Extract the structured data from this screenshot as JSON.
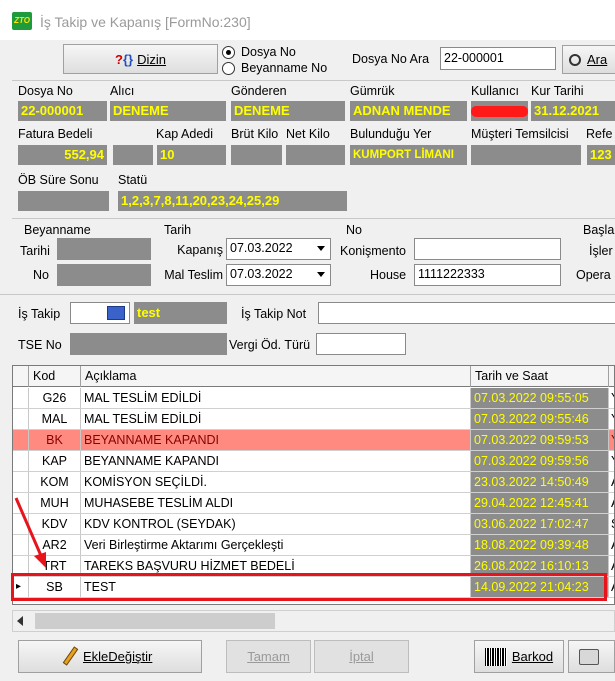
{
  "window": {
    "title": "İş Takip ve Kapanış [FormNo:230]",
    "icon_name": "app-logo-icon",
    "icon_text": "ZTO"
  },
  "toolbar": {
    "dizin_label": "Dizin",
    "radio_dosya": "Dosya No",
    "radio_beyanname": "Beyanname No",
    "radio_selected": "Dosya No",
    "dosya_ara_label": "Dosya No Ara",
    "dosya_ara_value": "22-000001",
    "search_label": "Ara"
  },
  "info": {
    "dosya_no_label": "Dosya No",
    "dosya_no": "22-000001",
    "alici_label": "Alıcı",
    "alici": "DENEME",
    "gonderen_label": "Gönderen",
    "gonderen": "DENEME",
    "gumruk_label": "Gümrük",
    "gumruk": "ADNAN MENDE",
    "kullanici_label": "Kullanıcı",
    "kur_tarihi_label": "Kur Tarihi",
    "kur_tarihi": "31.12.2021",
    "fatura_label": "Fatura Bedeli",
    "fatura": "552,94",
    "kap_adedi_label": "Kap Adedi",
    "kap_adedi": "10",
    "brut_label": "Brüt Kilo",
    "net_label": "Net Kilo",
    "bulundugu_label": "Bulunduğu Yer",
    "bulundugu": "KUMPORT LİMANI",
    "musteri_label": "Müşteri Temsilcisi",
    "refe_label": "Refe",
    "refe": "123",
    "ob_label": "ÖB Süre Sonu",
    "statu_label": "Statü",
    "statu": "1,2,3,7,8,11,20,23,24,25,29"
  },
  "beyanname": {
    "section_label": "Beyanname",
    "tarihi_label": "Tarihi",
    "no_label": "No",
    "tarih_section": "Tarih",
    "kapanis_label": "Kapanış",
    "kapanis": "07.03.2022",
    "mal_teslim_label": "Mal Teslim",
    "mal_teslim": "07.03.2022",
    "no_section": "No",
    "konisme_label": "Konişmento",
    "house_label": "House",
    "house": "1111222333",
    "basla_label": "Başla",
    "islem_label": "İşler",
    "opera_label": "Opera"
  },
  "is_takip": {
    "label": "İş Takip",
    "value": "test",
    "not_label": "İş Takip Not",
    "tse_label": "TSE No",
    "vergi_label": "Vergi Öd. Türü"
  },
  "grid": {
    "headers": [
      "Kod",
      "Açıklama",
      "Tarih ve Saat"
    ],
    "rows": [
      {
        "kod": "G26",
        "aciklama": "MAL TESLİM EDİLDİ",
        "tarih": "07.03.2022 09:55:05",
        "ext": "Y"
      },
      {
        "kod": "MAL",
        "aciklama": "MAL TESLİM EDİLDİ",
        "tarih": "07.03.2022 09:55:46",
        "ext": "Y"
      },
      {
        "kod": "BK",
        "aciklama": "BEYANNAME KAPANDI",
        "tarih": "07.03.2022 09:59:53",
        "ext": "Y"
      },
      {
        "kod": "KAP",
        "aciklama": "BEYANNAME  KAPANDI",
        "tarih": "07.03.2022 09:59:56",
        "ext": "Y"
      },
      {
        "kod": "KOM",
        "aciklama": "KOMİSYON SEÇİLDİ.",
        "tarih": "23.03.2022 14:50:49",
        "ext": "A"
      },
      {
        "kod": "MUH",
        "aciklama": "MUHASEBE TESLİM ALDI",
        "tarih": "29.04.2022 12:45:41",
        "ext": "A"
      },
      {
        "kod": "KDV",
        "aciklama": "KDV KONTROL (SEYDAK)",
        "tarih": "03.06.2022 17:02:47",
        "ext": "S"
      },
      {
        "kod": "AR2",
        "aciklama": "Veri Birleştirme Aktarımı Gerçekleşti",
        "tarih": "18.08.2022 09:39:48",
        "ext": "A"
      },
      {
        "kod": "TRT",
        "aciklama": "TAREKS BAŞVURU HİZMET BEDELİ",
        "tarih": "26.08.2022 16:10:13",
        "ext": "A"
      },
      {
        "kod": "SB",
        "aciklama": "TEST",
        "tarih": "14.09.2022 21:04:23",
        "ext": "A"
      }
    ]
  },
  "buttons": {
    "ekle": "EkleDeğiştir",
    "tamam": "Tamam",
    "iptal": "İptal",
    "barkod": "Barkod"
  },
  "colors": {
    "grey_field": "#8c8c8c",
    "yellow_text": "#ffff00",
    "highlight_row": "#ff8a80",
    "annotation_red": "#e8141c"
  }
}
